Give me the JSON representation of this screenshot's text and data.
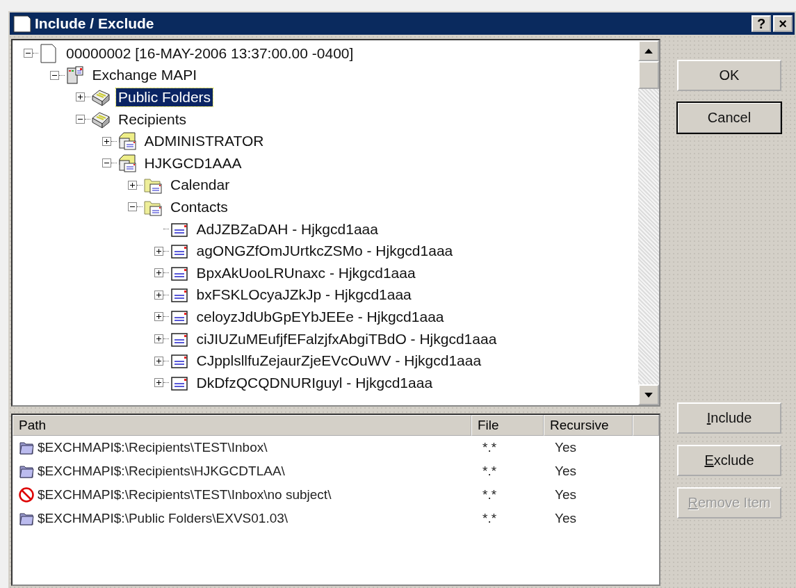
{
  "window": {
    "title": "Include / Exclude",
    "help_button": "?",
    "close_button": "×"
  },
  "tree": [
    {
      "label": "00000002 [16-MAY-2006 13:37:00.00 -0400]",
      "kind": "document",
      "expanded": true,
      "selected": false,
      "children": [
        {
          "label": "Exchange MAPI",
          "kind": "server",
          "expanded": true,
          "selected": false,
          "children": [
            {
              "label": "Public Folders",
              "kind": "store",
              "expanded": false,
              "selected": true
            },
            {
              "label": "Recipients",
              "kind": "store",
              "expanded": true,
              "selected": false,
              "children": [
                {
                  "label": "ADMINISTRATOR",
                  "kind": "mailbox",
                  "expanded": false,
                  "selected": false
                },
                {
                  "label": "HJKGCD1AAA",
                  "kind": "mailbox",
                  "expanded": true,
                  "selected": false,
                  "children": [
                    {
                      "label": "Calendar",
                      "kind": "folder",
                      "expanded": false,
                      "selected": false
                    },
                    {
                      "label": "Contacts",
                      "kind": "folder",
                      "expanded": true,
                      "selected": false,
                      "children": [
                        {
                          "label": "AdJZBZaDAH - Hjkgcd1aaa",
                          "kind": "card",
                          "selected": false
                        },
                        {
                          "label": "agONGZfOmJUrtkcZSMo - Hjkgcd1aaa",
                          "kind": "card",
                          "expanded": false,
                          "selected": false
                        },
                        {
                          "label": "BpxAkUooLRUnaxc - Hjkgcd1aaa",
                          "kind": "card",
                          "expanded": false,
                          "selected": false
                        },
                        {
                          "label": "bxFSKLOcyaJZkJp - Hjkgcd1aaa",
                          "kind": "card",
                          "expanded": false,
                          "selected": false
                        },
                        {
                          "label": "celoyzJdUbGpEYbJEEe - Hjkgcd1aaa",
                          "kind": "card",
                          "expanded": false,
                          "selected": false
                        },
                        {
                          "label": "ciJIUZuMEufjfEFalzjfxAbgiTBdO - Hjkgcd1aaa",
                          "kind": "card",
                          "expanded": false,
                          "selected": false
                        },
                        {
                          "label": "CJpplsllfuZejaurZjeEVcOuWV - Hjkgcd1aaa",
                          "kind": "card",
                          "expanded": false,
                          "selected": false
                        },
                        {
                          "label": "DkDfzQCQDNURIguyl - Hjkgcd1aaa",
                          "kind": "card",
                          "expanded": false,
                          "selected": false
                        }
                      ]
                    }
                  ]
                }
              ]
            }
          ]
        }
      ]
    }
  ],
  "list": {
    "columns": [
      "Path",
      "File",
      "Recursive"
    ],
    "rows": [
      {
        "kind": "folder",
        "path": "$EXCHMAPI$:\\Recipients\\TEST\\Inbox\\",
        "file": "*.*",
        "recursive": "Yes"
      },
      {
        "kind": "folder",
        "path": "$EXCHMAPI$:\\Recipients\\HJKGCDTLAA\\",
        "file": "*.*",
        "recursive": "Yes"
      },
      {
        "kind": "blocked",
        "path": "$EXCHMAPI$:\\Recipients\\TEST\\Inbox\\no subject\\",
        "file": "*.*",
        "recursive": "Yes"
      },
      {
        "kind": "folder",
        "path": "$EXCHMAPI$:\\Public Folders\\EXVS01.03\\",
        "file": "*.*",
        "recursive": "Yes"
      }
    ]
  },
  "buttons_top": [
    {
      "label": "OK",
      "disabled": false,
      "default": false
    },
    {
      "label": "Cancel",
      "disabled": false,
      "default": true
    }
  ],
  "buttons_bottom": [
    {
      "accel": "I",
      "rest": "nclude",
      "disabled": false
    },
    {
      "accel": "E",
      "rest": "xclude",
      "disabled": false
    },
    {
      "accel": "R",
      "rest": "emove Item",
      "disabled": true
    }
  ]
}
